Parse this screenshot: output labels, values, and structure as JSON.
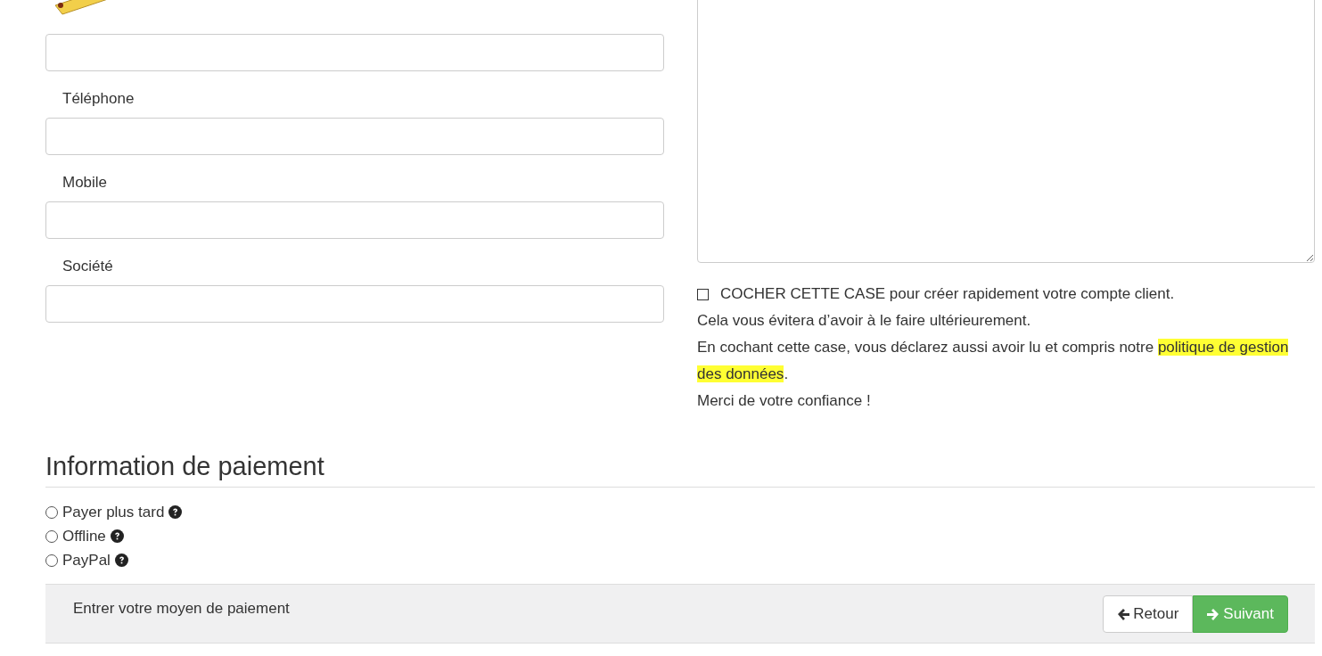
{
  "contact_fields": [
    {
      "kind": "text"
    },
    {
      "kind": "text",
      "label": "Téléphone"
    },
    {
      "kind": "text",
      "label": "Mobile"
    },
    {
      "kind": "text",
      "label": "Société"
    }
  ],
  "message": {
    "kind": "textarea"
  },
  "account": {
    "checked": false,
    "label": "COCHER CETTE CASE pour créer rapidement votre compte client.",
    "note": "Cela vous évitera d’avoir à le faire ultérieurement.",
    "consent_before": "En cochant cette case, vous déclarez aussi avoir lu et compris notre ",
    "consent_highlighted": "politique de gestion des données",
    "consent_after": ".",
    "thanks": "Merci de votre confiance !"
  },
  "payment": {
    "heading": "Information de paiement",
    "options": [
      {
        "label": "Payer plus tard",
        "selected": false
      },
      {
        "label": "Offline",
        "selected": false
      },
      {
        "label": "PayPal",
        "selected": false
      }
    ]
  },
  "footer": {
    "hint": "Entrer votre moyen de paiement",
    "buttons": [
      {
        "label": "Retour",
        "kind": "back"
      },
      {
        "label": "Suivant",
        "kind": "next"
      }
    ]
  }
}
